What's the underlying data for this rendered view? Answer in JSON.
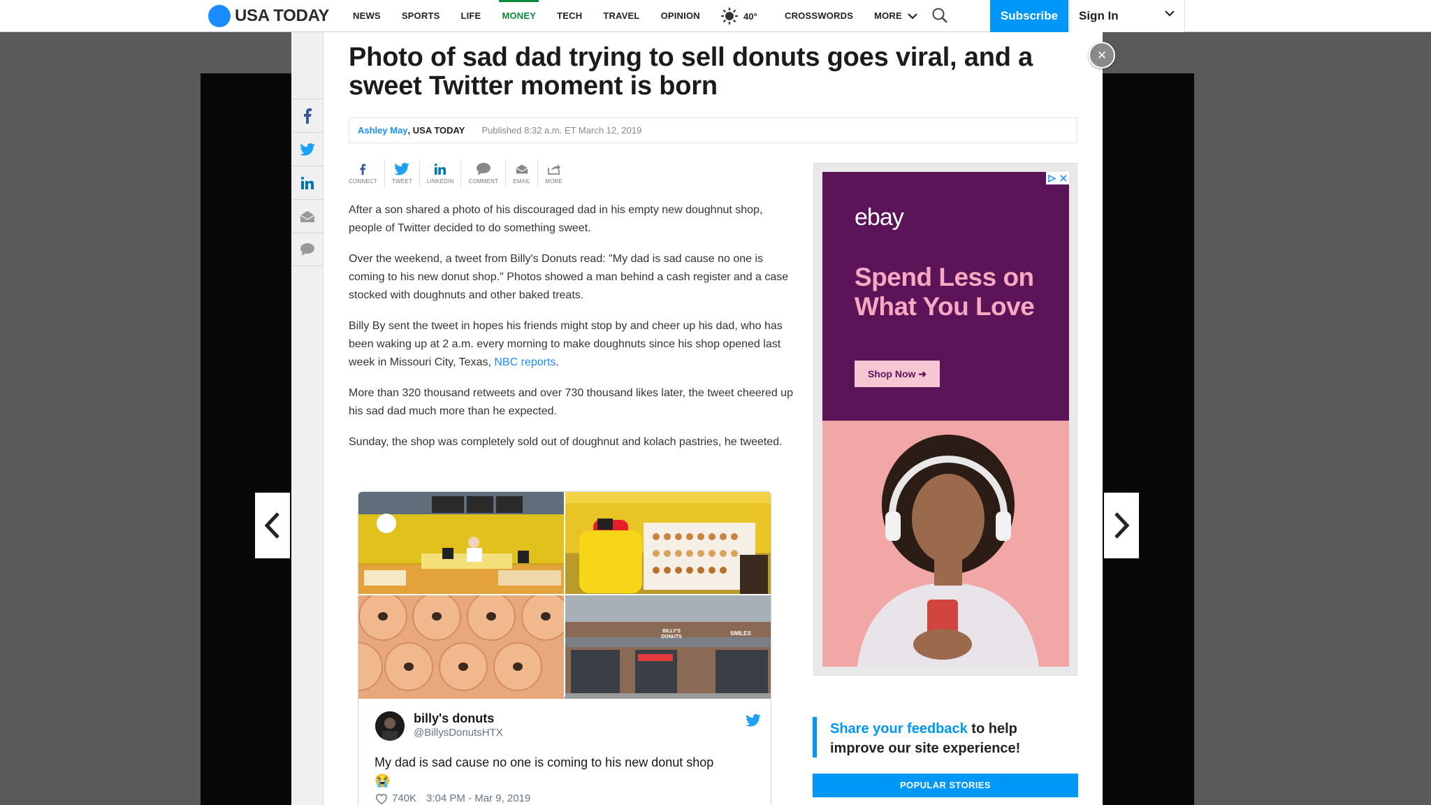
{
  "nav": {
    "brand": "USA TODAY",
    "links": [
      "NEWS",
      "SPORTS",
      "LIFE",
      "MONEY",
      "TECH",
      "TRAVEL",
      "OPINION"
    ],
    "active_link": "MONEY",
    "weather": "40°",
    "crosswords": "CROSSWORDS",
    "more": "MORE",
    "subscribe": "Subscribe",
    "sign_in": "Sign In",
    "colors": {
      "brand": "#1a8cff",
      "active": "#0c8a3c",
      "subscribe": "#0098f8"
    }
  },
  "article": {
    "headline": "Photo of sad dad trying to sell donuts goes viral, and a sweet Twitter moment is born",
    "author": "Ashley May",
    "org": ", USA TODAY",
    "published": "Published 8:32 a.m. ET March 12, 2019",
    "share_buttons": [
      {
        "label": "CONNECT",
        "icon": "facebook-icon"
      },
      {
        "label": "TWEET",
        "icon": "twitter-icon"
      },
      {
        "label": "LINKEDIN",
        "icon": "linkedin-icon"
      },
      {
        "label": "COMMENT",
        "icon": "comment-icon"
      },
      {
        "label": "EMAIL",
        "icon": "email-icon"
      },
      {
        "label": "MORE",
        "icon": "share-icon"
      }
    ],
    "paragraphs": [
      "After a son shared a photo of his discouraged dad in his empty new doughnut shop, people of Twitter decided to do something sweet.",
      "Over the weekend, a tweet from Billy's Donuts read: \"My dad is sad cause no one is coming to his new donut shop.\" Photos showed a man behind a cash register and a case stocked with doughnuts and other baked treats.",
      "Billy By sent the tweet in hopes his friends might stop by and cheer up his dad, who has been waking up at 2 a.m. every morning to make doughnuts since his shop opened last week in Missouri City, Texas, ",
      "More than 320 thousand retweets and over 730 thousand likes later, the tweet cheered up his sad dad much more than he expected.",
      "Sunday, the shop was completely sold out of doughnut and kolach pastries, he tweeted."
    ],
    "link_text": "NBC reports",
    "link_suffix": "."
  },
  "rail": [
    "facebook-icon",
    "twitter-icon",
    "linkedin-icon",
    "email-icon",
    "comment-icon"
  ],
  "tweet": {
    "name": "billy's donuts",
    "handle": "@BillysDonutsHTX",
    "text": "My dad is sad cause no one is coming to his new donut shop",
    "emoji": "😭",
    "likes": "740K",
    "time": "3:04 PM - Mar 9, 2019",
    "store_sign_1": "BILLY'S DONUTS",
    "store_sign_2": "SMILES"
  },
  "ad": {
    "logo": "ebay",
    "headline": "Spend Less on What You Love",
    "cta": "Shop Now ➜",
    "colors": {
      "top": "#5b1458",
      "bottom": "#f0a7a5",
      "headline": "#f7a9c2"
    }
  },
  "sidebar": {
    "feedback_highlight": "Share your feedback",
    "feedback_rest": " to help improve our site experience!",
    "popular": "POPULAR STORIES"
  }
}
